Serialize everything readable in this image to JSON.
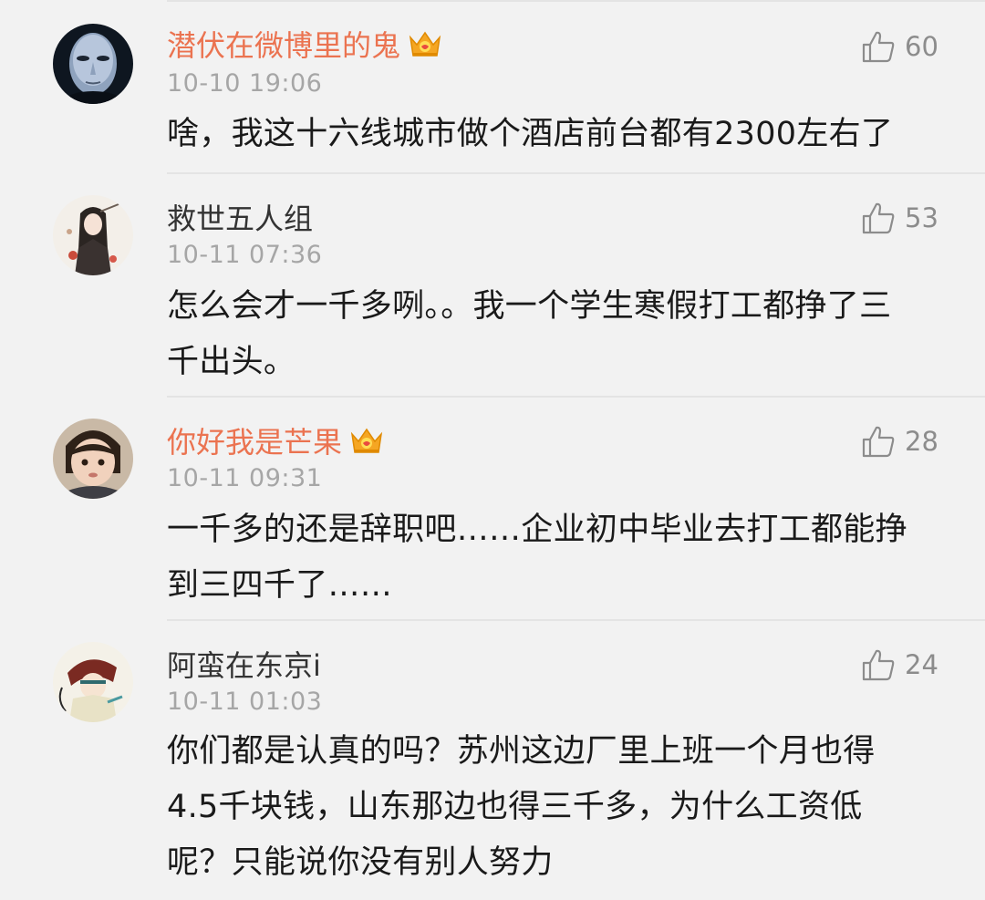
{
  "comments": [
    {
      "username": "潜伏在微博里的鬼",
      "vip": true,
      "avatar_icon": "mask-avatar-icon",
      "timestamp": "10-10 19:06",
      "likes": "60",
      "text_lines": [
        "啥，我这十六线城市做个酒店前台都有2300左右了"
      ]
    },
    {
      "username": "救世五人组",
      "vip": false,
      "avatar_icon": "anime-girl-avatar-icon",
      "timestamp": "10-11 07:36",
      "likes": "53",
      "text_lines": [
        "怎么会才一千多咧。。我一个学生寒假打工都挣了三",
        "千出头。"
      ]
    },
    {
      "username": "你好我是芒果",
      "vip": true,
      "avatar_icon": "child-photo-avatar-icon",
      "timestamp": "10-11 09:31",
      "likes": "28",
      "text_lines": [
        "一千多的还是辞职吧……企业初中毕业去打工都能挣",
        "到三四千了……"
      ]
    },
    {
      "username": "阿蛮在东京i",
      "vip": false,
      "avatar_icon": "anime-character-avatar-icon",
      "timestamp": "10-11 01:03",
      "likes": "24",
      "text_lines": [
        "你们都是认真的吗？苏州这边厂里上班一个月也得",
        "4.5千块钱，山东那边也得三千多，为什么工资低",
        "呢？只能说你没有别人努力"
      ]
    }
  ],
  "colors": {
    "background": "#f2f2f2",
    "vip_username": "#eb7350",
    "username": "#333333",
    "timestamp": "#a6a6a6",
    "text": "#1a1a1a",
    "like": "#8c8c8c",
    "crown": "#f5a623"
  }
}
